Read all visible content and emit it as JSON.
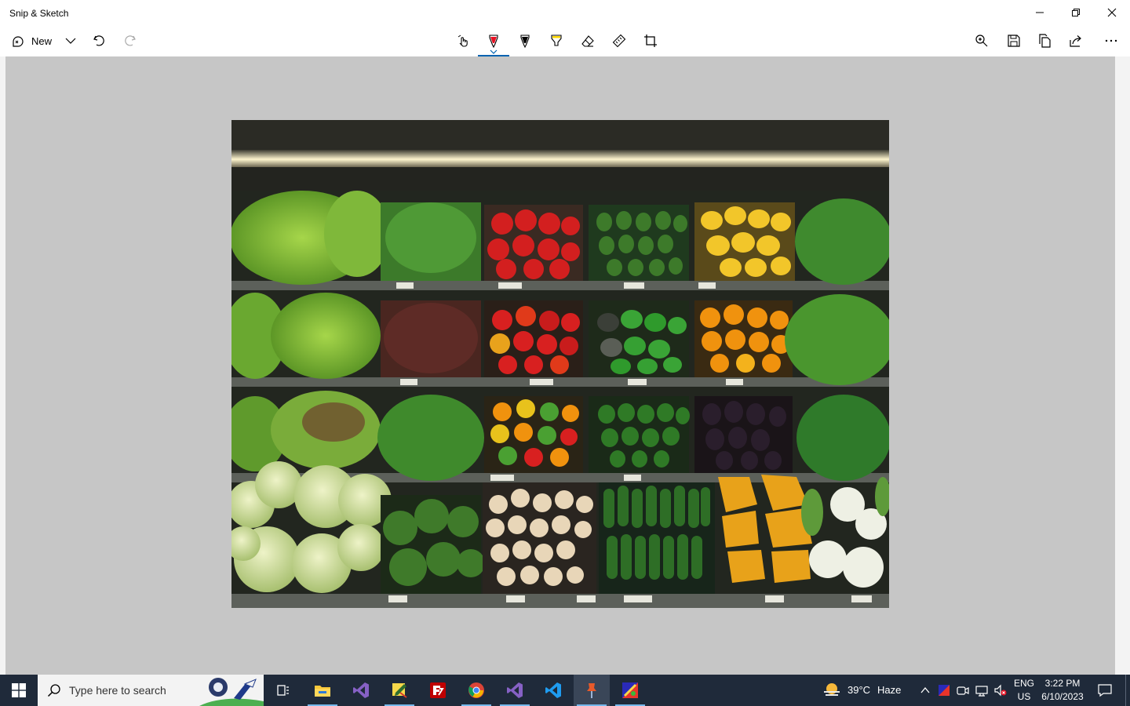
{
  "window": {
    "title": "Snip & Sketch"
  },
  "toolbar": {
    "new_label": "New",
    "tools": [
      {
        "name": "touch-writing-icon"
      },
      {
        "name": "ballpoint-pen-icon",
        "active": true,
        "color": "#e81123"
      },
      {
        "name": "pencil-icon",
        "color": "#000000"
      },
      {
        "name": "highlighter-icon",
        "color": "#ffd800"
      },
      {
        "name": "eraser-icon"
      },
      {
        "name": "ruler-icon"
      },
      {
        "name": "crop-icon"
      }
    ],
    "right_actions": [
      "zoom-icon",
      "save-icon",
      "copy-icon",
      "share-icon",
      "more-icon"
    ]
  },
  "taskbar": {
    "search_placeholder": "Type here to search",
    "apps": [
      "task-view-icon",
      "file-explorer-icon",
      "visual-studio-icon",
      "sticky-notes-icon",
      "filezilla-icon",
      "chrome-icon",
      "visual-studio-2-icon",
      "vscode-icon",
      "pin-app-icon",
      "paint-app-icon"
    ],
    "weather_temp": "39°C",
    "weather_desc": "Haze",
    "lang_top": "ENG",
    "lang_bottom": "US",
    "time": "3:22 PM",
    "date": "6/10/2023"
  },
  "colors": {
    "accent": "#0063b1",
    "canvas_bg": "#c6c6c6",
    "taskbar_bg": "#1f2a3a"
  }
}
